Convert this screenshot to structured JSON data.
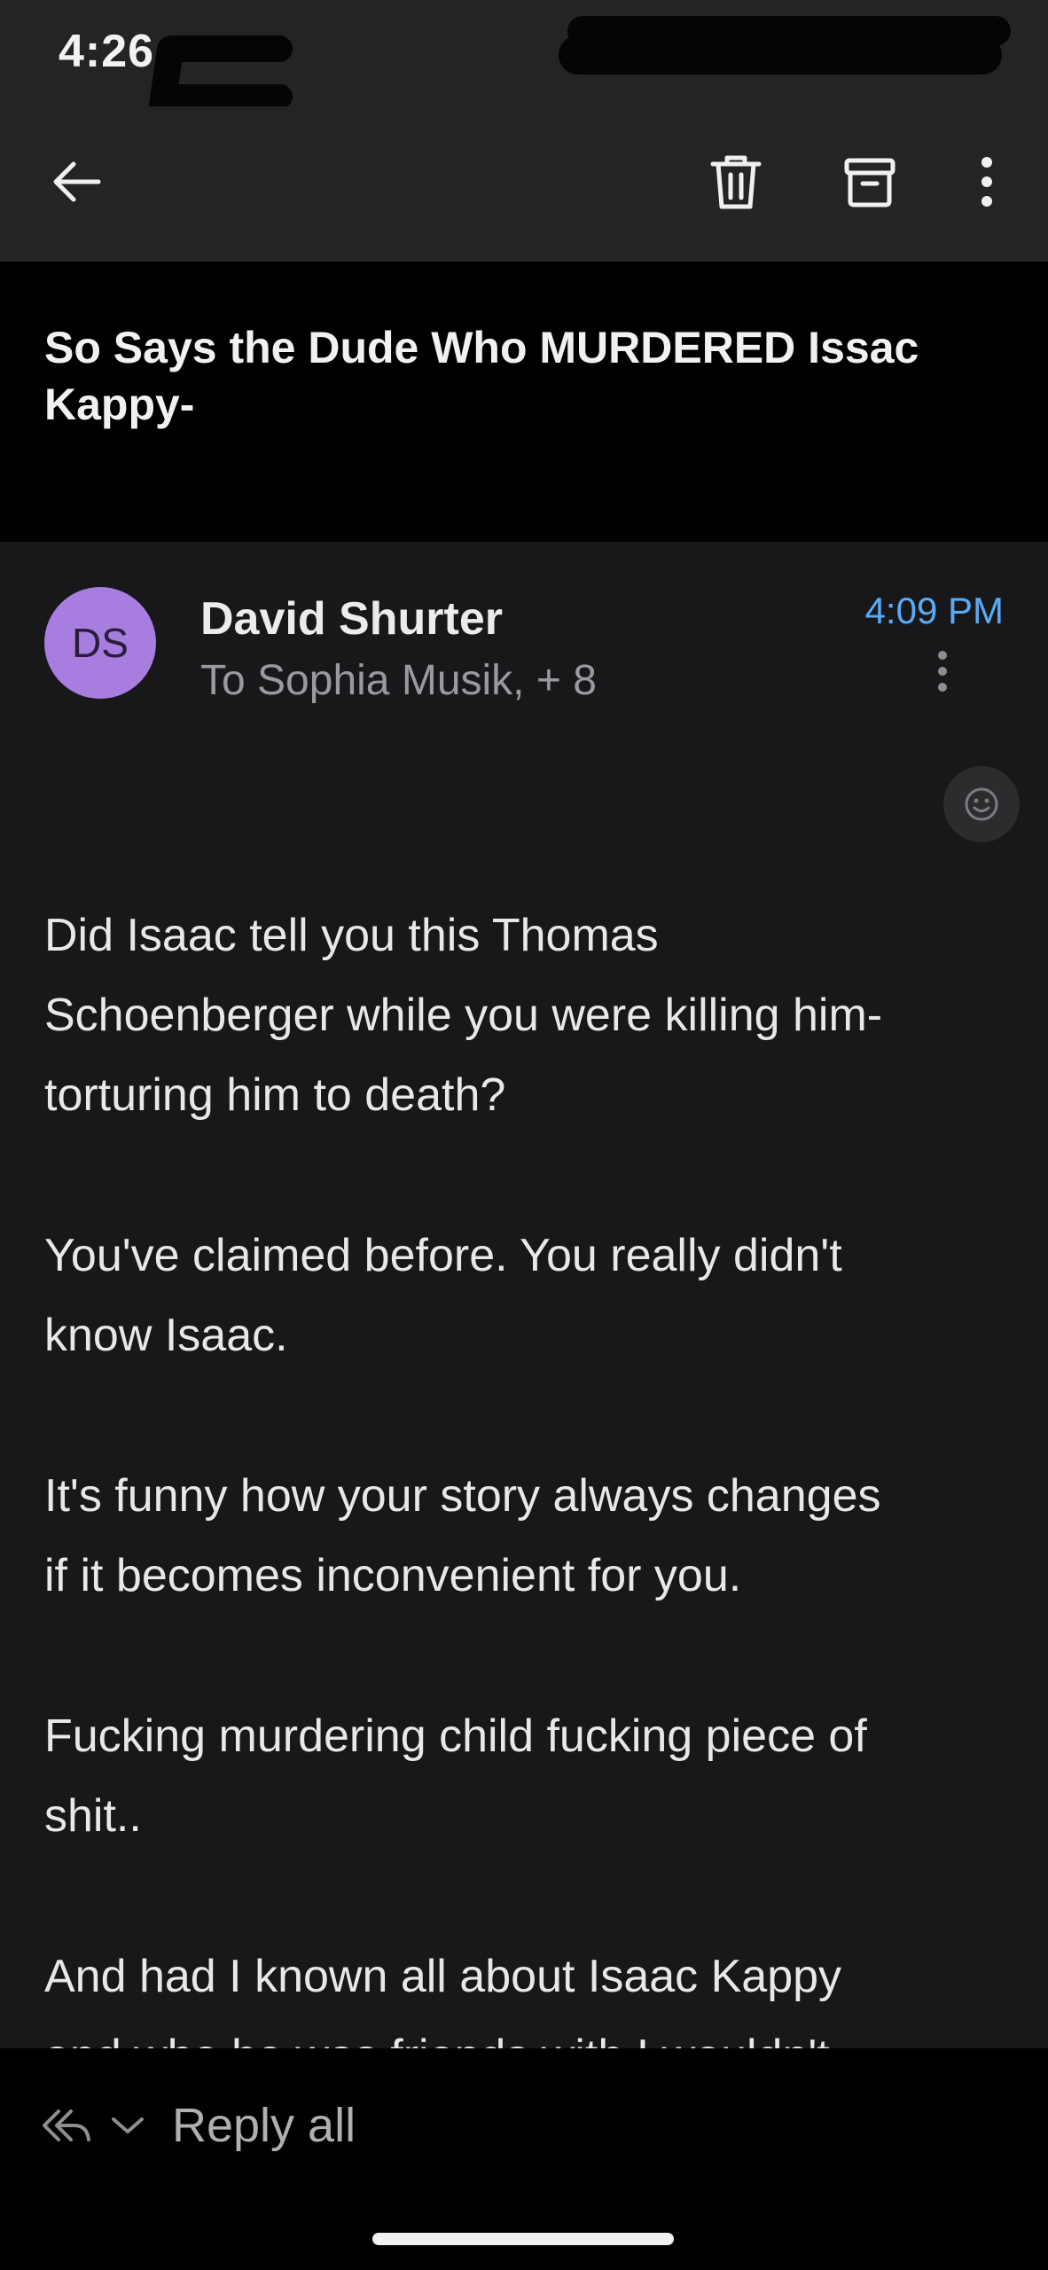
{
  "status_bar": {
    "time": "4:26"
  },
  "toolbar": {
    "back_icon": "arrow-left-icon",
    "delete_icon": "trash-icon",
    "archive_icon": "archive-icon",
    "more_icon": "more-vertical-icon"
  },
  "email": {
    "subject": "So Says the Dude Who MURDERED Issac Kappy-",
    "sender": {
      "initials": "DS",
      "name": "David Shurter",
      "avatar_color": "#a87de0"
    },
    "recipients": "To Sophia Musik, + 8",
    "time": "4:09 PM",
    "body": [
      "Did Isaac tell you this Thomas\nSchoenberger while you were killing him-\ntorturing him to death?",
      "You've claimed before. You really didn't\nknow Isaac.",
      "It's funny how your story always changes\nif it becomes inconvenient for you.",
      "Fucking murdering child fucking piece of\nshit..",
      "And had I known all about Isaac Kappy\nand who he was friends with I wouldn't"
    ]
  },
  "bottom_bar": {
    "reply_label": "Reply all",
    "reply_icon": "reply-all-icon",
    "dropdown_icon": "chevron-down-icon"
  },
  "colors": {
    "background": "#18181a",
    "toolbar": "#242426",
    "accent_time": "#5aaaf5"
  }
}
